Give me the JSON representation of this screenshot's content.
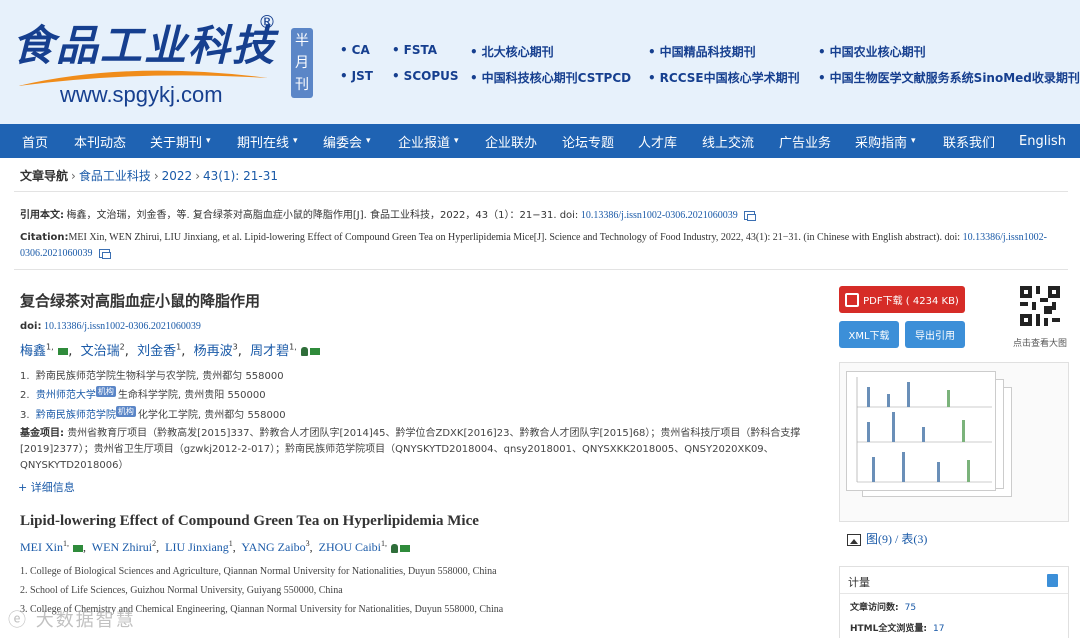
{
  "header": {
    "logo_title": "食品工业科技",
    "logo_reg": "®",
    "logo_url": "www.spgykj.com",
    "frequency": "半月刊",
    "indexes_row1": [
      "CA",
      "FSTA",
      "北大核心期刊",
      "中国精品科技期刊",
      "中国农业核心期刊"
    ],
    "indexes_row2": [
      "JST",
      "SCOPUS",
      "中国科技核心期刊CSTPCD",
      "RCCSE中国核心学术期刊",
      "中国生物医学文献服务系统SinoMed收录期刊"
    ]
  },
  "nav": [
    {
      "label": "首页",
      "dropdown": false
    },
    {
      "label": "本刊动态",
      "dropdown": false
    },
    {
      "label": "关于期刊",
      "dropdown": true
    },
    {
      "label": "期刊在线",
      "dropdown": true
    },
    {
      "label": "编委会",
      "dropdown": true
    },
    {
      "label": "企业报道",
      "dropdown": true
    },
    {
      "label": "企业联办",
      "dropdown": false
    },
    {
      "label": "论坛专题",
      "dropdown": false
    },
    {
      "label": "人才库",
      "dropdown": false
    },
    {
      "label": "线上交流",
      "dropdown": false
    },
    {
      "label": "广告业务",
      "dropdown": false
    },
    {
      "label": "采购指南",
      "dropdown": true
    },
    {
      "label": "联系我们",
      "dropdown": false
    },
    {
      "label": "English",
      "dropdown": false
    }
  ],
  "breadcrumb": {
    "label": "文章导航",
    "journal": "食品工业科技",
    "year": "2022",
    "issue": "43(1): 21-31"
  },
  "citation_cn": {
    "label": "引用本文:",
    "text": "梅鑫，文治瑞，刘金香，等. 复合绿茶对高脂血症小鼠的降脂作用[J]. 食品工业科技，2022，43（1）：21−31. doi:",
    "doi": "10.13386/j.issn1002-0306.2021060039"
  },
  "citation_en": {
    "label": "Citation:",
    "text": "MEI Xin, WEN Zhirui, LIU Jinxiang, et al. Lipid-lowering Effect of Compound Green Tea on Hyperlipidemia Mice[J]. Science and Technology of Food Industry, 2022, 43(1): 21−31. (in Chinese with English abstract). doi:",
    "doi": "10.13386/j.issn1002-0306.2021060039"
  },
  "article": {
    "title_cn": "复合绿茶对高脂血症小鼠的降脂作用",
    "doi_label": "doi:",
    "doi": "10.13386/j.issn1002-0306.2021060039",
    "authors_cn": [
      {
        "name": "梅鑫",
        "sup": "1, ",
        "mail": true,
        "person": false
      },
      {
        "name": "文治瑞",
        "sup": "2",
        "mail": false,
        "person": false
      },
      {
        "name": "刘金香",
        "sup": "1",
        "mail": false,
        "person": false
      },
      {
        "name": "杨再波",
        "sup": "3",
        "mail": false,
        "person": false
      },
      {
        "name": "周才碧",
        "sup": "1, ",
        "mail": true,
        "person": true
      }
    ],
    "affil_cn": [
      {
        "num": "1.",
        "tag": "",
        "text": "黔南民族师范学院生物科学与农学院, 贵州都匀 558000"
      },
      {
        "num": "2.",
        "tag": "机构",
        "pre": "贵州师范大学",
        "text": "生命科学学院, 贵州贵阳 550000"
      },
      {
        "num": "3.",
        "tag": "机构",
        "pre": "黔南民族师范学院",
        "text": "化学化工学院, 贵州都匀 558000"
      }
    ],
    "fund_label": "基金项目:",
    "fund_text": "贵州省教育厅项目（黔教高发[2015]337、黔教合人才团队字[2014]45、黔学位合ZDXK[2016]23、黔教合人才团队字[2015]68）；贵州省科技厅项目（黔科合支撑[2019]2377）；贵州省卫生厅项目（gzwkj2012-2-017）；黔南民族师范学院项目（QNYSKYTD2018004、qnsy2018001、QNYSXKK2018005、QNSY2020XK09、QNYSKYTD2018006）",
    "more_label": "+ 详细信息",
    "title_en": "Lipid-lowering Effect of Compound Green Tea on Hyperlipidemia Mice",
    "authors_en": [
      {
        "name": "MEI Xin",
        "sup": "1, ",
        "mail": true,
        "person": false
      },
      {
        "name": "WEN Zhirui",
        "sup": "2",
        "mail": false,
        "person": false
      },
      {
        "name": "LIU Jinxiang",
        "sup": "1",
        "mail": false,
        "person": false
      },
      {
        "name": "YANG Zaibo",
        "sup": "3",
        "mail": false,
        "person": false
      },
      {
        "name": "ZHOU Caibi",
        "sup": "1, ",
        "mail": true,
        "person": true
      }
    ],
    "affil_en": [
      "1.   College of Biological Sciences and Agriculture, Qiannan Normal University for Nationalities, Duyun 558000, China",
      "2.   School of Life Sciences, Guizhou Normal University, Guiyang 550000, China",
      "3.   College of Chemistry and Chemical Engineering, Qiannan Normal University for Nationalities, Duyun 558000, China"
    ]
  },
  "sidebar": {
    "pdf_label": "PDF下载 ( 4234 KB)",
    "xml_label": "XML下载",
    "cite_label": "导出引用",
    "qr_label": "点击查看大图",
    "figs_label": "图(9)",
    "figs_sep": " / ",
    "tables_label": "表(3)",
    "stats_title": "计量",
    "visits_label": "文章访问数:",
    "visits": "75",
    "html_label": "HTML全文浏览量:",
    "html_views": "17"
  },
  "watermark": "ⓔ 大数据智慧",
  "colors": {
    "nav_bg": "#1f63b3",
    "header_bg": "#e7f1fb",
    "link": "#1a5aa8",
    "pdf_button": "#d62c27",
    "blue_button": "#3c8fd8"
  }
}
